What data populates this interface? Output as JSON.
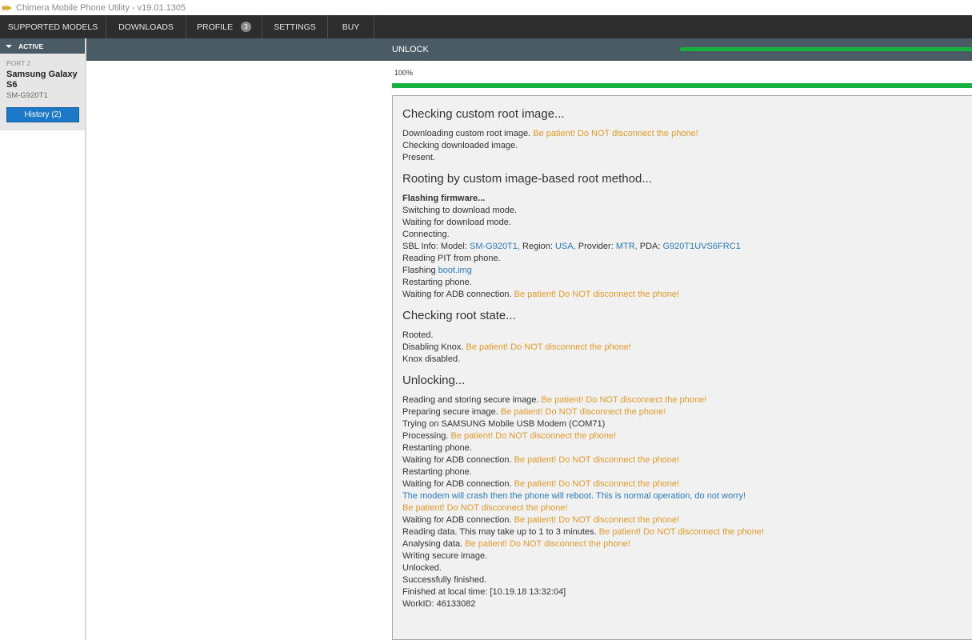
{
  "window": {
    "title": "Chimera Mobile Phone Utility - v19.01.1305"
  },
  "menu": {
    "items": [
      {
        "label": "SUPPORTED MODELS"
      },
      {
        "label": "DOWNLOADS"
      },
      {
        "label": "PROFILE",
        "badge": "3"
      },
      {
        "label": "SETTINGS"
      },
      {
        "label": "BUY"
      }
    ]
  },
  "sidebar": {
    "active_label": "ACTIVE",
    "port": "PORT 2",
    "device_name": "Samsung Galaxy S6",
    "device_model": "SM-G920T1",
    "history_button": "History (2)"
  },
  "header": {
    "title": "UNLOCK",
    "progress": 1.0
  },
  "progress": {
    "percent_label": "100%",
    "value": 1.0
  },
  "colors": {
    "warning": "#e29a2a",
    "info": "#2b7bb9",
    "progress": "#16b03c",
    "header_bg": "#4a5b66",
    "menu_bg": "#2d2d2d"
  },
  "log": {
    "sections": [
      {
        "heading": "Checking custom root image...",
        "lines": [
          [
            {
              "t": "Downloading custom root image. "
            },
            {
              "t": "Be patient! Do NOT disconnect the phone!",
              "s": "warn"
            }
          ],
          [
            {
              "t": "Checking downloaded image."
            }
          ],
          [
            {
              "t": "Present."
            }
          ]
        ]
      },
      {
        "heading": "Rooting by custom image-based root method...",
        "lines": [
          [
            {
              "t": "Flashing firmware...",
              "s": "bold"
            }
          ],
          [
            {
              "t": "Switching to download mode."
            }
          ],
          [
            {
              "t": "Waiting for download mode."
            }
          ],
          [
            {
              "t": "Connecting."
            }
          ],
          [
            {
              "t": "SBL Info: Model: "
            },
            {
              "t": "SM-G920T1,",
              "s": "info"
            },
            {
              "t": " Region: "
            },
            {
              "t": "USA,",
              "s": "info"
            },
            {
              "t": " Provider: "
            },
            {
              "t": "MTR,",
              "s": "info"
            },
            {
              "t": " PDA: "
            },
            {
              "t": "G920T1UVS6FRC1",
              "s": "info"
            }
          ],
          [
            {
              "t": "Reading PIT from phone."
            }
          ],
          [
            {
              "t": "Flashing "
            },
            {
              "t": "boot.img",
              "s": "info"
            }
          ],
          [
            {
              "t": "Restarting phone."
            }
          ],
          [
            {
              "t": "Waiting for ADB connection. "
            },
            {
              "t": "Be patient! Do NOT disconnect the phone!",
              "s": "warn"
            }
          ]
        ]
      },
      {
        "heading": "Checking root state...",
        "lines": [
          [
            {
              "t": "Rooted."
            }
          ],
          [
            {
              "t": "Disabling Knox. "
            },
            {
              "t": "Be patient! Do NOT disconnect the phone!",
              "s": "warn"
            }
          ],
          [
            {
              "t": "Knox disabled."
            }
          ]
        ]
      },
      {
        "heading": "Unlocking...",
        "lines": [
          [
            {
              "t": "Reading and storing secure image. "
            },
            {
              "t": "Be patient! Do NOT disconnect the phone!",
              "s": "warn"
            }
          ],
          [
            {
              "t": "Preparing secure image. "
            },
            {
              "t": "Be patient! Do NOT disconnect the phone!",
              "s": "warn"
            }
          ],
          [
            {
              "t": "Trying on SAMSUNG Mobile USB Modem (COM71)"
            }
          ],
          [
            {
              "t": "Processing. "
            },
            {
              "t": "Be patient! Do NOT disconnect the phone!",
              "s": "warn"
            }
          ],
          [
            {
              "t": "Restarting phone."
            }
          ],
          [
            {
              "t": "Waiting for ADB connection. "
            },
            {
              "t": "Be patient! Do NOT disconnect the phone!",
              "s": "warn"
            }
          ],
          [
            {
              "t": "Restarting phone."
            }
          ],
          [
            {
              "t": "Waiting for ADB connection. "
            },
            {
              "t": "Be patient! Do NOT disconnect the phone!",
              "s": "warn"
            }
          ],
          [
            {
              "t": "The modem will crash then the phone will reboot. This is normal operation, do not worry!",
              "s": "info"
            }
          ],
          [
            {
              "t": "Be patient! Do NOT disconnect the phone!",
              "s": "warn"
            }
          ],
          [
            {
              "t": "Waiting for ADB connection. "
            },
            {
              "t": "Be patient! Do NOT disconnect the phone!",
              "s": "warn"
            }
          ],
          [
            {
              "t": "Reading data. This may take up to 1 to 3 minutes. "
            },
            {
              "t": "Be patient! Do NOT disconnect the phone!",
              "s": "warn"
            }
          ],
          [
            {
              "t": "Analysing data. "
            },
            {
              "t": "Be patient! Do NOT disconnect the phone!",
              "s": "warn"
            }
          ],
          [
            {
              "t": "Writing secure image."
            }
          ],
          [
            {
              "t": "Unlocked."
            }
          ],
          [
            {
              "t": "Successfully finished."
            }
          ],
          [
            {
              "t": "Finished at local time: [10.19.18 13:32:04]"
            }
          ],
          [
            {
              "t": "WorkID: 46133082"
            }
          ]
        ]
      }
    ]
  }
}
